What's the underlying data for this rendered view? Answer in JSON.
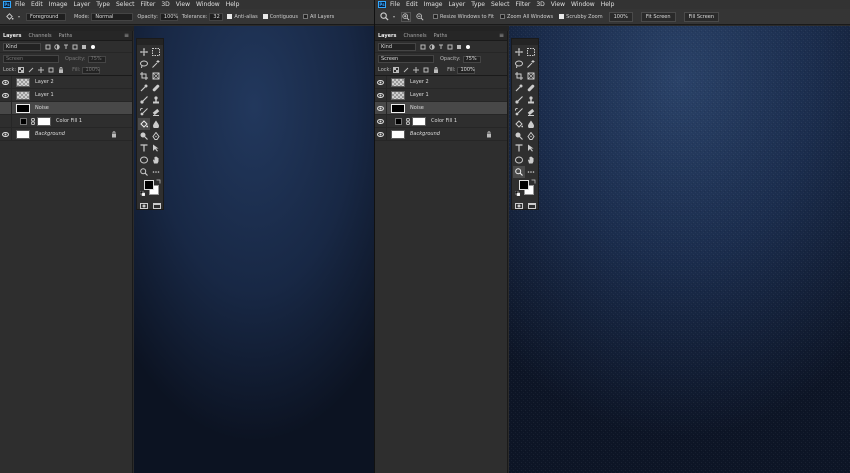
{
  "app": {
    "logo_text": "Ps"
  },
  "menu": [
    "File",
    "Edit",
    "Image",
    "Layer",
    "Type",
    "Select",
    "Filter",
    "3D",
    "View",
    "Window",
    "Help"
  ],
  "left": {
    "options": {
      "tool_icon": "paint-bucket-icon",
      "source_value": "Foreground",
      "mode_label": "Mode:",
      "mode_value": "Normal",
      "opacity_label": "Opacity:",
      "opacity_value": "100%",
      "tolerance_label": "Tolerance:",
      "tolerance_value": "32",
      "anti_alias_label": "Anti-alias",
      "anti_alias_checked": true,
      "contiguous_label": "Contiguous",
      "contiguous_checked": true,
      "all_layers_label": "All Layers",
      "all_layers_checked": false
    },
    "layers_panel": {
      "tabs": [
        "Layers",
        "Channels",
        "Paths"
      ],
      "kind_value": "Kind",
      "blend_value": "Screen",
      "opacity_label": "Opacity:",
      "opacity_value": "75%",
      "lock_label": "Lock:",
      "fill_label": "Fill:",
      "fill_value": "100%",
      "layers": [
        {
          "name": "Layer 2",
          "thumb": "transparent",
          "visible": true,
          "selected": false
        },
        {
          "name": "Layer 1",
          "thumb": "transparent",
          "visible": true,
          "selected": false
        },
        {
          "name": "Noise",
          "thumb": "black",
          "visible": false,
          "selected": true
        },
        {
          "name": "Color Fill 1",
          "thumb": "fill",
          "visible": false,
          "selected": false
        },
        {
          "name": "Background",
          "thumb": "white",
          "visible": true,
          "selected": false,
          "locked": true
        }
      ]
    }
  },
  "right": {
    "options": {
      "tool_icon": "zoom-icon",
      "resize_label": "Resize Windows to Fit",
      "resize_checked": false,
      "zoom_all_label": "Zoom All Windows",
      "zoom_all_checked": false,
      "scrubby_label": "Scrubby Zoom",
      "scrubby_checked": true,
      "zoom_value": "100%",
      "fit_screen_label": "Fit Screen",
      "fill_screen_label": "Fill Screen"
    },
    "layers_panel": {
      "tabs": [
        "Layers",
        "Channels",
        "Paths"
      ],
      "kind_value": "Kind",
      "blend_value": "Screen",
      "opacity_label": "Opacity:",
      "opacity_value": "75%",
      "lock_label": "Lock:",
      "fill_label": "Fill:",
      "fill_value": "100%",
      "layers": [
        {
          "name": "Layer 2",
          "thumb": "transparent",
          "visible": true,
          "selected": false
        },
        {
          "name": "Layer 1",
          "thumb": "transparent",
          "visible": true,
          "selected": false
        },
        {
          "name": "Noise",
          "thumb": "black",
          "visible": true,
          "selected": true
        },
        {
          "name": "Color Fill 1",
          "thumb": "fill",
          "visible": true,
          "selected": false
        },
        {
          "name": "Background",
          "thumb": "white",
          "visible": true,
          "selected": false,
          "locked": true
        }
      ]
    }
  },
  "colors": {
    "canvas_dark": "#0c1322",
    "canvas_light": "#22385d",
    "selected_row": "#484848",
    "ps_blue": "#31a8ff"
  },
  "toolbar_icons": [
    "move-icon",
    "marquee-icon",
    "lasso-icon",
    "magic-wand-icon",
    "crop-icon",
    "frame-icon",
    "eyedropper-icon",
    "healing-brush-icon",
    "brush-icon",
    "clone-stamp-icon",
    "history-brush-icon",
    "eraser-icon",
    "paint-bucket-icon",
    "blur-icon",
    "dodge-icon",
    "pen-icon",
    "type-icon",
    "path-select-icon",
    "ellipse-icon",
    "hand-icon",
    "zoom-icon",
    "more-tools-icon"
  ]
}
